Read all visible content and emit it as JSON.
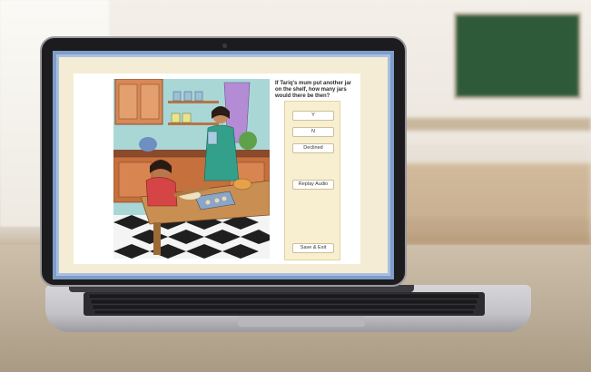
{
  "assessment": {
    "question": "If Tariq's mum put another jar on the shelf, how many jars would there be then?",
    "buttons": {
      "yes": "Y",
      "no": "N",
      "declined": "Declined",
      "replay_audio": "Replay Audio",
      "save_exit": "Save & Exit"
    }
  },
  "colors": {
    "screen_border": "#7f9dc9",
    "frame": "#f4ecd5",
    "panel": "#f8efd0",
    "chalkboard": "#2f5a3a"
  }
}
